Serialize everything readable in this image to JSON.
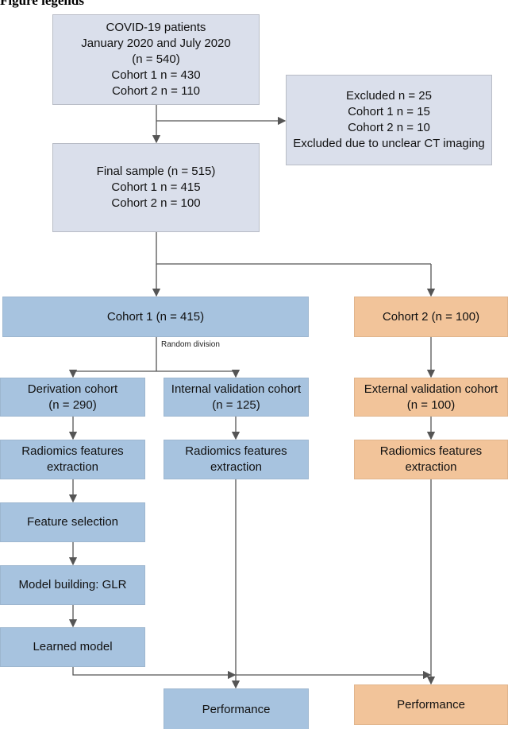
{
  "title": "Figure legends",
  "nodes": {
    "patients": [
      "COVID-19 patients",
      "January 2020 and July 2020",
      "(n = 540)",
      "Cohort 1 n = 430",
      "Cohort 2 n = 110"
    ],
    "excluded": [
      "Excluded n = 25",
      "Cohort 1 n = 15",
      "Cohort 2 n = 10",
      "Excluded due to unclear CT imaging"
    ],
    "final": [
      "Final sample (n = 515)",
      "Cohort 1 n = 415",
      "Cohort 2 n = 100"
    ],
    "cohort1": "Cohort 1 (n = 415)",
    "cohort2": "Cohort 2 (n = 100)",
    "random_division": "Random division",
    "derivation": [
      "Derivation cohort",
      "(n = 290)"
    ],
    "internal": [
      "Internal validation cohort",
      "(n = 125)"
    ],
    "external": [
      "External validation cohort",
      "(n = 100)"
    ],
    "radiomics": [
      "Radiomics features",
      "extraction"
    ],
    "feature_selection": "Feature selection",
    "model_building": "Model building: GLR",
    "learned_model": "Learned model",
    "performance": "Performance"
  },
  "colors": {
    "gray": "#dadfeb",
    "cohort1": "#a7c3df",
    "cohort2": "#f2c49a",
    "line": "#555555"
  }
}
